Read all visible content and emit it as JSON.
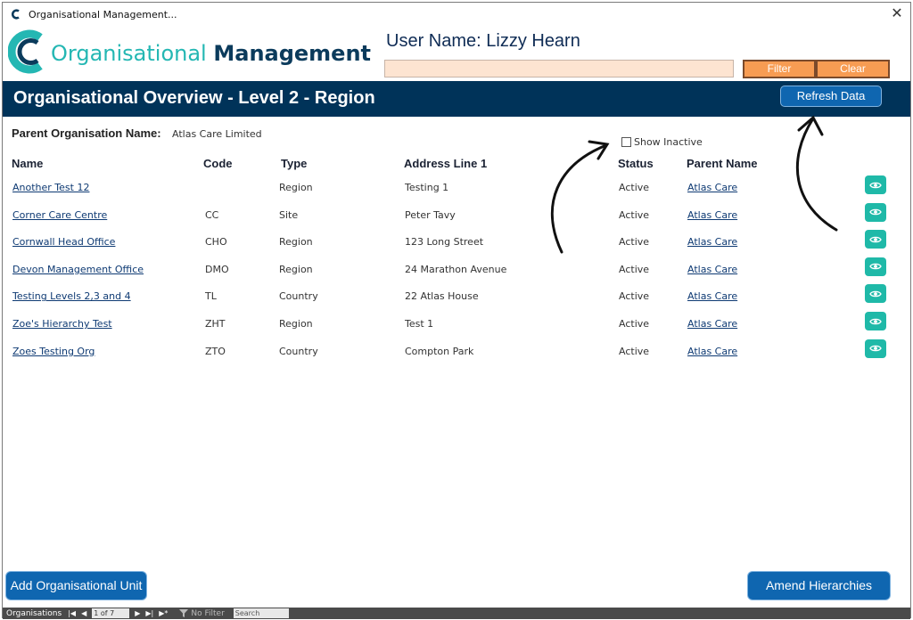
{
  "window": {
    "title": "Organisational Management...",
    "close_glyph": "✕"
  },
  "logo": {
    "part1": "Organisational",
    "part2": "Management",
    "icon": "c-logo-icon"
  },
  "header": {
    "user_name": "User Name: Lizzy Hearn",
    "filter_value": "",
    "filter_button": "Filter",
    "clear_button": "Clear"
  },
  "banner": {
    "title": "Organisational Overview - Level 2 - Region",
    "refresh_button": "Refresh Data"
  },
  "parent": {
    "label": "Parent Organisation Name:",
    "value": "Atlas Care Limited"
  },
  "show_inactive": {
    "label": "Show Inactive",
    "checked": false
  },
  "table": {
    "columns": [
      "Name",
      "Code",
      "Type",
      "Address Line 1",
      "Status",
      "Parent Name"
    ],
    "rows": [
      {
        "name": "Another Test 12",
        "code": "",
        "type": "Region",
        "address": "Testing 1",
        "status": "Active",
        "parent": "Atlas Care"
      },
      {
        "name": "Corner Care Centre",
        "code": "CC",
        "type": "Site",
        "address": "Peter Tavy",
        "status": "Active",
        "parent": "Atlas Care"
      },
      {
        "name": "Cornwall Head Office",
        "code": "CHO",
        "type": "Region",
        "address": "123 Long Street",
        "status": "Active",
        "parent": "Atlas Care"
      },
      {
        "name": "Devon Management Office",
        "code": "DMO",
        "type": "Region",
        "address": "24 Marathon Avenue",
        "status": "Active",
        "parent": "Atlas Care"
      },
      {
        "name": "Testing Levels 2,3 and 4",
        "code": "TL",
        "type": "Country",
        "address": "22 Atlas House",
        "status": "Active",
        "parent": "Atlas Care"
      },
      {
        "name": "Zoe's Hierarchy Test",
        "code": "ZHT",
        "type": "Region",
        "address": "Test 1",
        "status": "Active",
        "parent": "Atlas Care"
      },
      {
        "name": "Zoes Testing Org",
        "code": "ZTO",
        "type": "Country",
        "address": "Compton Park",
        "status": "Active",
        "parent": "Atlas Care"
      }
    ]
  },
  "footer": {
    "add_button": "Add Organisational Unit",
    "amend_button": "Amend Hierarchies"
  },
  "navigator": {
    "label": "Organisations",
    "first": "|◀",
    "prev": "◀",
    "position": "1 of 7",
    "next": "▶",
    "last": "▶|",
    "new": "▶*",
    "filter_status": "No Filter",
    "search_placeholder": "Search"
  },
  "colors": {
    "teal": "#24b7b3",
    "navy": "#003359",
    "orange": "#f79c53",
    "blue_button": "#0f66b0",
    "eye_button": "#1fb9a8"
  }
}
